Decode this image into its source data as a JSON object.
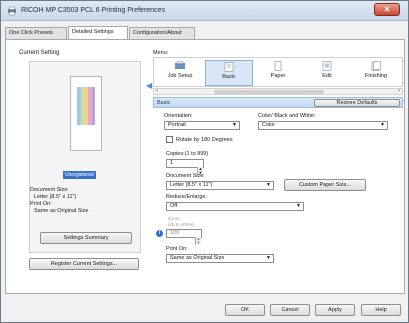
{
  "window": {
    "title": "RICOH MP C3503 PCL 6 Printing Preferences",
    "close_label": "✕"
  },
  "tabs": [
    {
      "label": "One Click Presets",
      "active": false
    },
    {
      "label": "Detailed Settings",
      "active": true
    },
    {
      "label": "Configuration/About",
      "active": false
    }
  ],
  "left": {
    "title": "Current Setting",
    "highlight": "Unregistered",
    "doc_size_label": "Document Size:",
    "doc_size_value": "Letter (8.5\" x 11\")",
    "print_on_label": "Print On:",
    "print_on_value": "Same as Original Size",
    "settings_summary_label": "Settings Summary",
    "register_label": "Register Current Settings..."
  },
  "menu": {
    "label": "Menu:",
    "items": [
      {
        "label": "Job Setup",
        "icon": "job-setup-icon"
      },
      {
        "label": "Basic",
        "icon": "basic-icon"
      },
      {
        "label": "Paper",
        "icon": "paper-icon"
      },
      {
        "label": "Edit",
        "icon": "edit-icon"
      },
      {
        "label": "Finishing",
        "icon": "finishing-icon"
      }
    ]
  },
  "section": {
    "title": "Basic",
    "restore_label": "Restore Defaults"
  },
  "form": {
    "orientation_label": "Orientation:",
    "orientation_value": "Portrait",
    "color_label": "Color/ Black and White:",
    "color_value": "Color",
    "rotate_label": "Rotate by 180 Degrees",
    "copies_label": "Copies:(1 to 999)",
    "copies_value": "1",
    "doc_size_label": "Document Size:",
    "doc_size_value": "Letter (8.5\" x 11\")",
    "custom_paper_label": "Custom Paper Size...",
    "reduce_label": "Reduce/Enlarge:",
    "reduce_value": "Off",
    "zoom_label": "Zoom:",
    "zoom_range": "(25 to 400%)",
    "zoom_value": "100",
    "print_on_label": "Print On:",
    "print_on_value": "Same as Original Size"
  },
  "buttons": {
    "ok": "OK",
    "cancel": "Cancel",
    "apply": "Apply",
    "help": "Help"
  }
}
